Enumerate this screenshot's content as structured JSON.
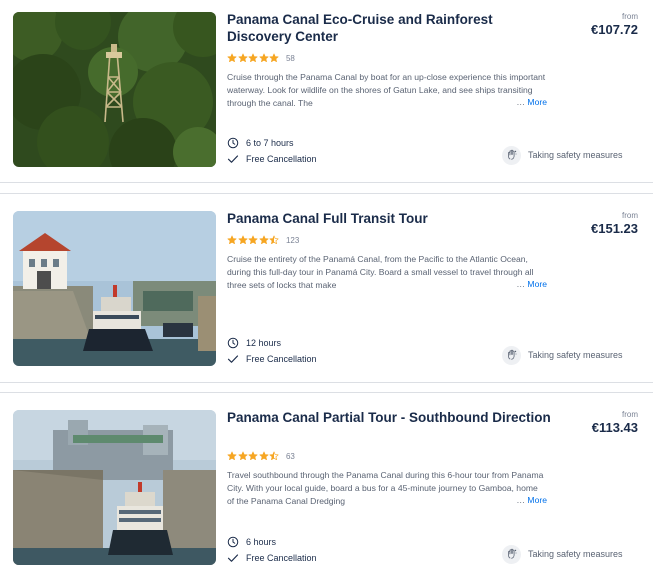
{
  "listings": [
    {
      "title": "Panama Canal Eco-Cruise and Rainforest Discovery Center",
      "rating": 5,
      "rating_count": "58",
      "description": "Cruise through the Panama Canal by boat for an up-close experience this important waterway. Look for wildlife on the shores of Gatun Lake, and see ships transiting through the canal. The",
      "more_label": "More",
      "duration": "6 to 7 hours",
      "cancellation": "Free Cancellation",
      "price_from_label": "from",
      "price": "€107.72",
      "safety": "Taking safety measures",
      "image": "rainforest-observation-tower"
    },
    {
      "title": "Panama Canal Full Transit Tour",
      "rating": 4.5,
      "rating_count": "123",
      "description": "Cruise the entirety of the Panamá Canal, from the Pacific to the Atlantic Ocean, during this full-day tour in Panamá City. Board a small vessel to travel through all three sets of locks that make",
      "more_label": "More",
      "duration": "12 hours",
      "cancellation": "Free Cancellation",
      "price_from_label": "from",
      "price": "€151.23",
      "safety": "Taking safety measures",
      "image": "canal-lock-control-house-boat"
    },
    {
      "title": "Panama Canal Partial Tour - Southbound Direction",
      "rating": 4.5,
      "rating_count": "63",
      "description": "Travel southbound through the Panama Canal during this 6-hour tour from Panama City. With your local guide, board a bus for a 45-minute journey to Gamboa, home of the Panama Canal Dredging",
      "more_label": "More",
      "duration": "6 hours",
      "cancellation": "Free Cancellation",
      "price_from_label": "from",
      "price": "€113.43",
      "safety": "Taking safety measures",
      "image": "canal-lock-tour-boat"
    }
  ],
  "colors": {
    "star": "#f6a623",
    "star_empty": "#dcdfe4",
    "link": "#0071eb",
    "text": "#1a2b49"
  },
  "icons": {
    "favorite": "heart-icon",
    "duration": "clock-icon",
    "cancellation": "check-icon",
    "safety": "hand-wash-icon"
  }
}
